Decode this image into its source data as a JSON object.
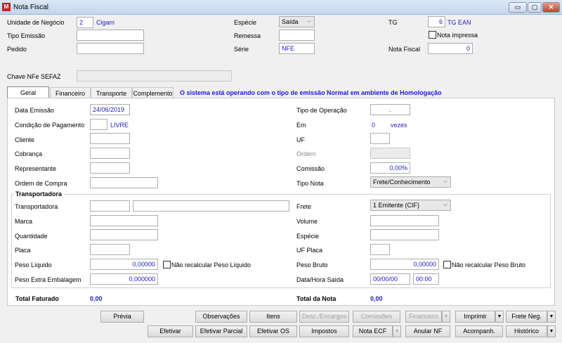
{
  "window": {
    "title": "Nota Fiscal",
    "minimize": "▭",
    "restore": "▢",
    "close": "✕"
  },
  "header": {
    "unidade_label": "Unidade de Negócio",
    "unidade_value": "2",
    "unidade_name": "Cigam",
    "tipo_emissao_label": "Tipo Emissão",
    "tipo_emissao_value": "",
    "pedido_label": "Pedido",
    "pedido_value": "",
    "especie_label": "Espécie",
    "especie_value": "Saída",
    "remessa_label": "Remessa",
    "remessa_value": "",
    "serie_label": "Série",
    "serie_value": "NFE",
    "tg_label": "TG",
    "tg_value": "6",
    "tg_name": "TG EAN",
    "nota_impressa_label": "Nota impressa",
    "nota_impressa_checked": false,
    "nota_fiscal_label": "Nota Fiscal",
    "nota_fiscal_value": "0",
    "chave_label": "Chave NFe SEFAZ",
    "chave_value": ""
  },
  "tabs": [
    {
      "label": "Geral",
      "active": true
    },
    {
      "label": "Financeiro"
    },
    {
      "label": "Transporte"
    },
    {
      "label": "Complemento"
    }
  ],
  "status_message": "O sistema está operando com o tipo de emissão Normal em ambiente de Homologação",
  "geral": {
    "data_emissao_label": "Data Emissão",
    "data_emissao_value": "24/06/2019",
    "condicao_label": "Condição de Pagamento",
    "condicao_value": "",
    "condicao_name": "LIVRE",
    "cliente_label": "Cliente",
    "cobranca_label": "Cobrança",
    "representante_label": "Representante",
    "ordem_compra_label": "Ordem de Compra",
    "tipo_operacao_label": "Tipo de Operação",
    "tipo_operacao_value": ".",
    "em_label": "Em",
    "em_value": "0",
    "em_unit": "vezes",
    "uf_label": "UF",
    "ordem_label": "Ordem",
    "comissao_label": "Comissão",
    "comissao_value": "0,00%",
    "tipo_nota_label": "Tipo Nota",
    "tipo_nota_value": "Frete/Conhecimento"
  },
  "transportadora": {
    "group_title": "Transportadora",
    "transportadora_label": "Transportadora",
    "marca_label": "Marca",
    "quantidade_label": "Quantidade",
    "placa_label": "Placa",
    "peso_liquido_label": "Peso Líquido",
    "peso_liquido_value": "0,00000",
    "nao_recalc_liq_label": "Não recalcular Peso Líquido",
    "peso_extra_label": "Peso Extra Embalagem",
    "peso_extra_value": "0,000000",
    "frete_label": "Frete",
    "frete_value": "1 Emitente (CIF)",
    "volume_label": "Volume",
    "especie_label": "Espécie",
    "uf_placa_label": "UF Placa",
    "peso_bruto_label": "Peso Bruto",
    "peso_bruto_value": "0,00000",
    "nao_recalc_bruto_label": "Não recalcular Peso Bruto",
    "data_hora_label": "Data/Hora Saída",
    "data_saida_value": "00/00/00",
    "hora_saida_value": "00:00"
  },
  "totals": {
    "faturado_label": "Total Faturado",
    "faturado_value": "0,00",
    "nota_label": "Total da Nota",
    "nota_value": "0,00"
  },
  "buttons": {
    "previa": "Prévia",
    "observacoes": "Observações",
    "itens": "Itens",
    "desc_encargos": "Desc./Encargos",
    "comissoes": "Comissões",
    "financeiro": "Financeiro",
    "imprimir": "Imprimir",
    "frete_neg": "Frete Neg.",
    "efetivar": "Efetivar",
    "efetivar_parcial": "Efetivar Parcial",
    "efetivar_os": "Efetivar OS",
    "impostos": "Impostos",
    "nota_ecf": "Nota ECF",
    "anular_nf": "Anular NF",
    "acompanh": "Acompanh.",
    "historico": "Histórico"
  }
}
